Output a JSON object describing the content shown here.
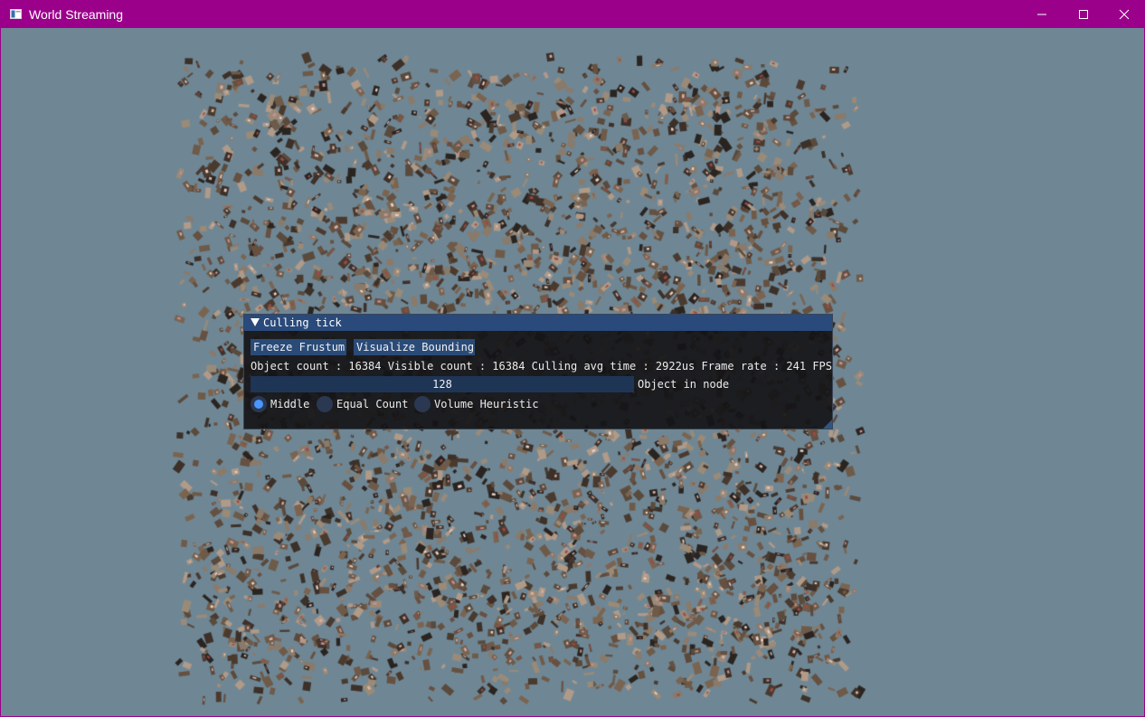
{
  "window": {
    "title": "World Streaming",
    "icon": "app-window-icon",
    "controls": [
      "minimize-icon",
      "maximize-icon",
      "close-icon"
    ],
    "title_bar_color": "#9b008b",
    "background_color": "#6f8795"
  },
  "panel": {
    "title": "Culling tick",
    "collapse_icon": "triangle-down-icon",
    "buttons": {
      "freeze": "Freeze Frustum",
      "visualize": "Visualize Bounding"
    },
    "stats": "Object count : 16384 Visible count : 16384 Culling avg time : 2922us Frame rate : 241 FPS",
    "slider": {
      "value": "128",
      "label": "Object in node"
    },
    "split_modes": {
      "selected": "Middle",
      "options": [
        "Middle",
        "Equal Count",
        "Volume Heuristic"
      ]
    },
    "accent_color": "#4a96ff",
    "header_color": "#294a7a"
  }
}
